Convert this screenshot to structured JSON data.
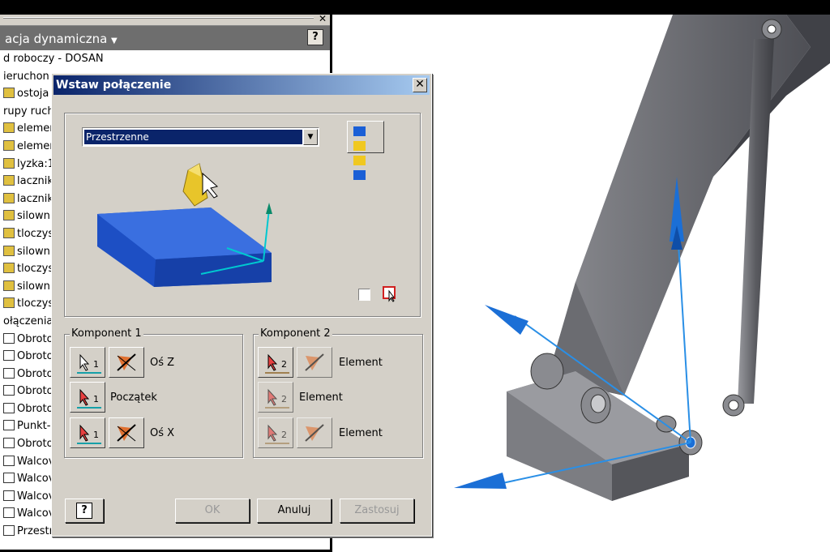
{
  "browser": {
    "header": "acja dynamiczna",
    "tree": [
      {
        "label": "d roboczy - DOSAN",
        "icon": "none"
      },
      {
        "label": "ieruchon",
        "icon": "none"
      },
      {
        "label": "ostoja",
        "icon": "part"
      },
      {
        "label": "rupy ruch",
        "icon": "none"
      },
      {
        "label": "elemen",
        "icon": "part"
      },
      {
        "label": "elemen",
        "icon": "part"
      },
      {
        "label": "lyzka:1",
        "icon": "part"
      },
      {
        "label": "lacznik",
        "icon": "part"
      },
      {
        "label": "lacznik",
        "icon": "part"
      },
      {
        "label": "silown",
        "icon": "part"
      },
      {
        "label": "tloczys",
        "icon": "part"
      },
      {
        "label": "silown",
        "icon": "part"
      },
      {
        "label": "tloczys",
        "icon": "part"
      },
      {
        "label": "silown",
        "icon": "part"
      },
      {
        "label": "tloczys",
        "icon": "part"
      },
      {
        "label": "ołączenia",
        "icon": "none"
      },
      {
        "label": "Obroto",
        "icon": "joint"
      },
      {
        "label": "Obroto",
        "icon": "joint"
      },
      {
        "label": "Obroto",
        "icon": "joint"
      },
      {
        "label": "Obroto",
        "icon": "joint"
      },
      {
        "label": "Obroto",
        "icon": "joint"
      },
      {
        "label": "Punkt-",
        "icon": "joint"
      },
      {
        "label": "Obroto",
        "icon": "joint"
      },
      {
        "label": "Walcov",
        "icon": "joint"
      },
      {
        "label": "Walcov",
        "icon": "joint"
      },
      {
        "label": "Walcov",
        "icon": "joint"
      },
      {
        "label": "Walcov",
        "icon": "joint"
      },
      {
        "label": "Przestr",
        "icon": "joint"
      }
    ]
  },
  "dialog": {
    "title": "Wstaw połączenie",
    "joint_type": "Przestrzenne",
    "component1": {
      "title": "Komponent 1",
      "rows": [
        {
          "label": "Oś Z",
          "index": "1"
        },
        {
          "label": "Początek",
          "index": "1"
        },
        {
          "label": "Oś X",
          "index": "1"
        }
      ]
    },
    "component2": {
      "title": "Komponent 2",
      "rows": [
        {
          "label": "Element",
          "index": "2"
        },
        {
          "label": "Element",
          "index": "2"
        },
        {
          "label": "Element",
          "index": "2"
        }
      ]
    },
    "buttons": {
      "ok": "OK",
      "cancel": "Anuluj",
      "apply": "Zastosuj",
      "help": "?"
    }
  },
  "colors": {
    "title_bar": "#0a246a",
    "accent_blue": "#1b6fd6",
    "part_gray": "#6f7075"
  }
}
